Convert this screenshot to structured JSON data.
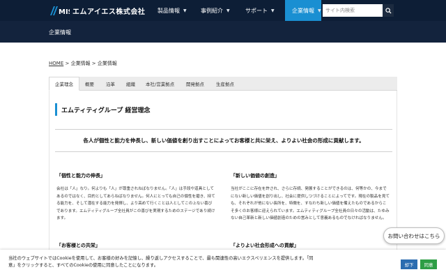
{
  "header": {
    "logo_text": "エムアイエス株式会社",
    "logo_mark_label": "MIS",
    "nav": [
      {
        "label": "製品情報"
      },
      {
        "label": "事例紹介"
      },
      {
        "label": "サポート"
      },
      {
        "label": "企業情報",
        "active": true
      }
    ],
    "search_placeholder": "サイト内検索",
    "accent_color": "#1a8fd2"
  },
  "subheader": {
    "title": "企業情報"
  },
  "breadcrumb": {
    "home": "HOME",
    "sep1": " > ",
    "level1": "企業情報",
    "sep2": " > ",
    "current": "企業情報"
  },
  "tabs": [
    {
      "label": "企業理念",
      "active": true
    },
    {
      "label": "概要"
    },
    {
      "label": "沿革"
    },
    {
      "label": "組織"
    },
    {
      "label": "本社/営業拠点"
    },
    {
      "label": "開発拠点"
    },
    {
      "label": "生産拠点"
    }
  ],
  "main": {
    "heading": "エムティティグループ 経営理念",
    "motto": "各人が個性と能力を伸長し、新しい価値を創り出すことによってお客様と共に栄え、よりよい社会の形成に貢献します。",
    "principles": [
      {
        "title": "「個性と能力の伸長」",
        "body": "会社は「人」なり。何よりも「人」が尊重されねばなりません。「人」は手段や道具としてあるのではなく、目的としてあらねばなりません。何人にとっても自己の個性を磨き、持てる能力を、そして潜在する能力を発揮し、より高めて行くことは人としてこの上ない喜びであります。エムティティグループ全社員がこの喜びを実現するためのステージであり続けます。"
      },
      {
        "title": "「新しい価値の創造」",
        "body": "当社がここに存在を許され、さらに存続、発展することができるのは、何等かの、今までにない新しい価値を創り出し、社会に提供しつづけることによってです。現在の製品を見ても、それぞれが他にない長所を、特徴を、すなわち新しい価値を備えたものであるからこそ多くのお客様に迎えられています。エムティティグループ全社員の日々の活動は、たゆみない自己革新と新しい価値創造のための営みとして意義あるものでなければなりません。"
      },
      {
        "title": "「お客様との共栄」",
        "body": ""
      },
      {
        "title": "「よりよい社会形成への貢献」",
        "body": ""
      }
    ]
  },
  "contact_button": "お問い合わせはこちら",
  "cookie": {
    "text": "当社のウェブサイトではCookieを使用して、お客様の好みを記憶し、繰り返しアクセスすることで、最も関連性の高いエクスペリエンスを提供します。「同意」をクリックすると、すべてのCookieの使用に同意したことになります。",
    "decline": "却下",
    "accept": "同意",
    "decline_color": "#2b6cb0",
    "accept_color": "#2e9e45"
  }
}
